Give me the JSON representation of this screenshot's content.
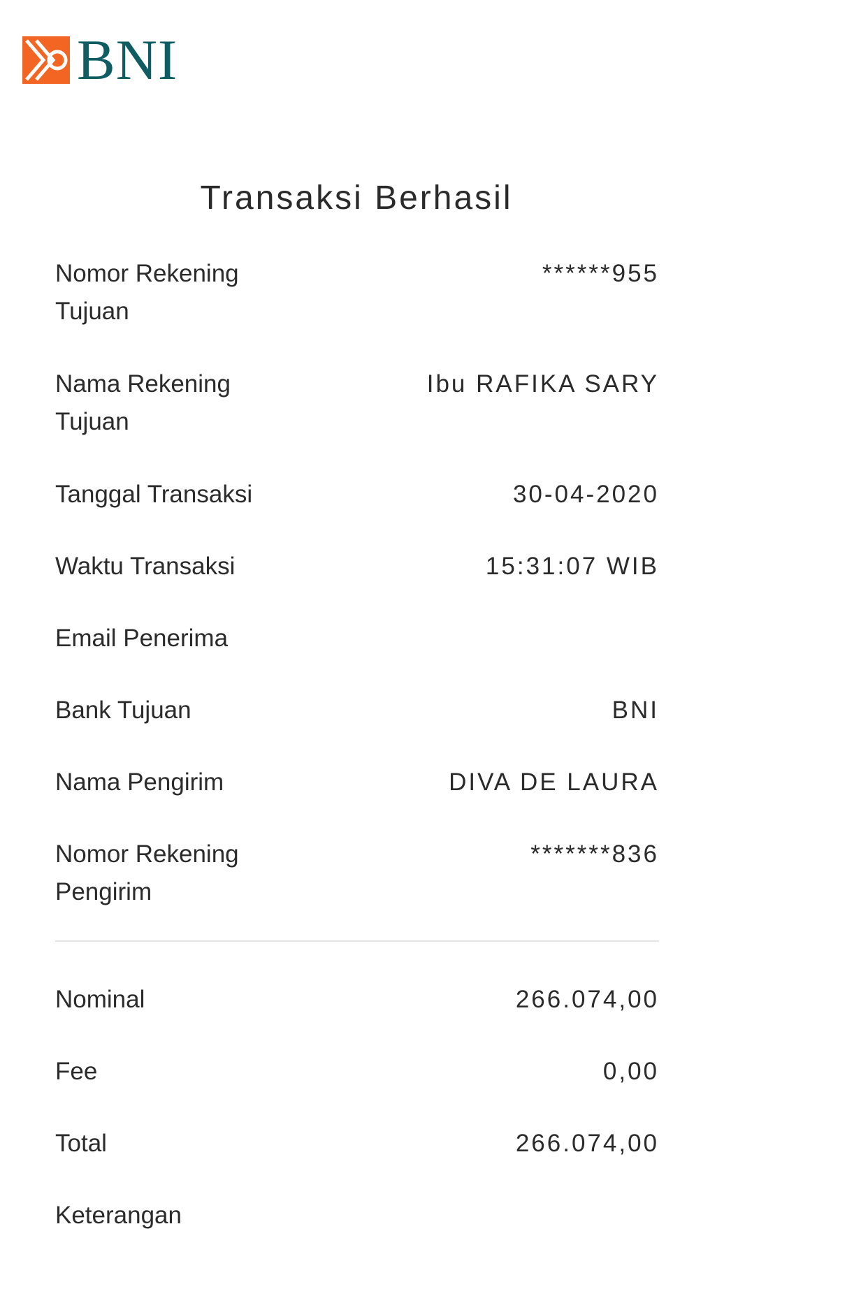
{
  "brand": {
    "name": "BNI",
    "primary_color": "#0f5c62",
    "accent_color": "#f26522"
  },
  "title": "Transaksi Berhasil",
  "details": [
    {
      "label": "Nomor Rekening Tujuan",
      "value": "******955"
    },
    {
      "label": "Nama Rekening Tujuan",
      "value": "Ibu RAFIKA SARY"
    },
    {
      "label": "Tanggal Transaksi",
      "value": "30-04-2020"
    },
    {
      "label": "Waktu Transaksi",
      "value": "15:31:07 WIB"
    },
    {
      "label": "Email Penerima",
      "value": ""
    },
    {
      "label": "Bank Tujuan",
      "value": "BNI"
    },
    {
      "label": "Nama Pengirim",
      "value": "DIVA DE LAURA"
    },
    {
      "label": "Nomor Rekening Pengirim",
      "value": "*******836"
    }
  ],
  "summary": [
    {
      "label": "Nominal",
      "value": "266.074,00"
    },
    {
      "label": "Fee",
      "value": "0,00"
    },
    {
      "label": "Total",
      "value": "266.074,00"
    },
    {
      "label": "Keterangan",
      "value": ""
    }
  ]
}
